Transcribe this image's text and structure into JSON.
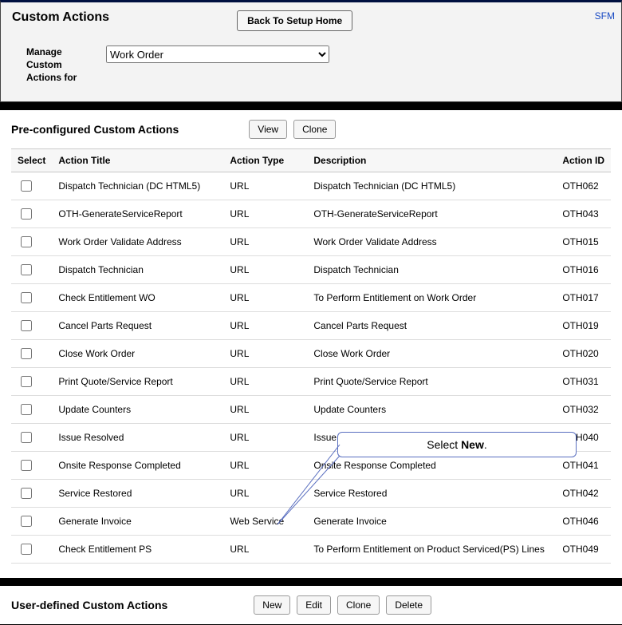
{
  "header": {
    "title": "Custom Actions",
    "back_btn": "Back To Setup Home",
    "sfm": "SFM"
  },
  "manage": {
    "label_l1": "Manage",
    "label_l2": "Custom",
    "label_l3": "Actions for",
    "selected": "Work Order"
  },
  "preconf": {
    "title": "Pre-configured Custom Actions",
    "view_btn": "View",
    "clone_btn": "Clone",
    "cols": {
      "select": "Select",
      "title": "Action Title",
      "type": "Action Type",
      "desc": "Description",
      "id": "Action ID"
    },
    "rows": [
      {
        "title": "Dispatch Technician (DC HTML5)",
        "type": "URL",
        "desc": "Dispatch Technician (DC HTML5)",
        "id": "OTH062"
      },
      {
        "title": "OTH-GenerateServiceReport",
        "type": "URL",
        "desc": "OTH-GenerateServiceReport",
        "id": "OTH043"
      },
      {
        "title": "Work Order Validate Address",
        "type": "URL",
        "desc": "Work Order Validate Address",
        "id": "OTH015"
      },
      {
        "title": "Dispatch Technician",
        "type": "URL",
        "desc": "Dispatch Technician",
        "id": "OTH016"
      },
      {
        "title": "Check Entitlement WO",
        "type": "URL",
        "desc": "To Perform Entitlement on Work Order",
        "id": "OTH017"
      },
      {
        "title": "Cancel Parts Request",
        "type": "URL",
        "desc": "Cancel Parts Request",
        "id": "OTH019"
      },
      {
        "title": "Close Work Order",
        "type": "URL",
        "desc": "Close Work Order",
        "id": "OTH020"
      },
      {
        "title": "Print Quote/Service Report",
        "type": "URL",
        "desc": "Print Quote/Service Report",
        "id": "OTH031"
      },
      {
        "title": "Update Counters",
        "type": "URL",
        "desc": "Update Counters",
        "id": "OTH032"
      },
      {
        "title": "Issue Resolved",
        "type": "URL",
        "desc": "Issue Resolved",
        "id": "OTH040"
      },
      {
        "title": "Onsite Response Completed",
        "type": "URL",
        "desc": "Onsite Response Completed",
        "id": "OTH041"
      },
      {
        "title": "Service Restored",
        "type": "URL",
        "desc": "Service Restored",
        "id": "OTH042"
      },
      {
        "title": "Generate Invoice",
        "type": "Web Service",
        "desc": "Generate Invoice",
        "id": "OTH046"
      },
      {
        "title": "Check Entitlement PS",
        "type": "URL",
        "desc": "To Perform Entitlement on Product Serviced(PS) Lines",
        "id": "OTH049"
      }
    ]
  },
  "userdef": {
    "title": "User-defined Custom Actions",
    "new_btn": "New",
    "edit_btn": "Edit",
    "clone_btn": "Clone",
    "delete_btn": "Delete"
  },
  "callout": {
    "prefix": "Select ",
    "bold": "New",
    "suffix": "."
  }
}
